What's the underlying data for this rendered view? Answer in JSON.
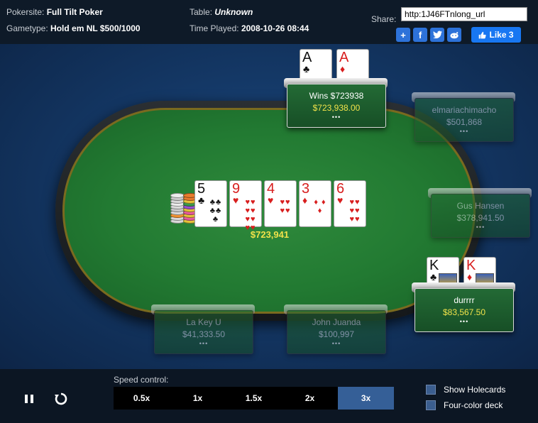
{
  "header": {
    "pokersite_label": "Pokersite:",
    "pokersite_value": "Full Tilt Poker",
    "gametype_label": "Gametype:",
    "gametype_value": "Hold em NL $500/1000",
    "table_label": "Table:",
    "table_value": "Unknown",
    "time_label": "Time Played:",
    "time_value": "2008-10-26 08:44",
    "share_label": "Share:",
    "share_url": "http:1J46FTnlong_url",
    "fb_like_label": "Like 3"
  },
  "board": {
    "cards": [
      {
        "rank": "5",
        "suit": "♣",
        "color": "black",
        "pips": "♣♣ ♣♣ ♣"
      },
      {
        "rank": "9",
        "suit": "♥",
        "color": "red",
        "pips": "♥♥ ♥♥ ♥♥ ♥♥"
      },
      {
        "rank": "4",
        "suit": "♥",
        "color": "red",
        "pips": "♥♥ ♥♥"
      },
      {
        "rank": "3",
        "suit": "♦",
        "color": "red",
        "pips": "♦ ♦ ♦"
      },
      {
        "rank": "6",
        "suit": "♥",
        "color": "red",
        "pips": "♥♥ ♥♥ ♥♥"
      }
    ],
    "pot": "$723,941"
  },
  "seats": [
    {
      "name": "Wins $723938",
      "stack": "$723,938.00",
      "state": "active",
      "cards": [
        {
          "rank": "A",
          "suit": "♣",
          "color": "black"
        },
        {
          "rank": "A",
          "suit": "♦",
          "color": "red"
        }
      ]
    },
    {
      "name": "elmariachimacho",
      "stack": "$501,868",
      "state": "folded",
      "cards": []
    },
    {
      "name": "Gus Hansen",
      "stack": "$378,941.50",
      "state": "folded",
      "cards": []
    },
    {
      "name": "durrrr",
      "stack": "$83,567.50",
      "state": "active",
      "cards": [
        {
          "rank": "K",
          "suit": "♣",
          "color": "black"
        },
        {
          "rank": "K",
          "suit": "♦",
          "color": "red"
        }
      ]
    },
    {
      "name": "John Juanda",
      "stack": "$100,997",
      "state": "folded",
      "cards": []
    },
    {
      "name": "La Key U",
      "stack": "$41,333.50",
      "state": "folded",
      "cards": []
    }
  ],
  "seat_dots": "•••",
  "controls": {
    "speed_label": "Speed control:",
    "speeds": [
      "0.5x",
      "1x",
      "1.5x",
      "2x",
      "3x"
    ],
    "selected_speed": "3x",
    "show_holecards": "Show Holecards",
    "four_color_deck": "Four-color deck"
  },
  "icons": {
    "pause": "pause-icon",
    "replay": "replay-icon"
  },
  "colors": {
    "accent": "#355f97",
    "pot": "#f0e24a",
    "felt": "#227a32"
  }
}
